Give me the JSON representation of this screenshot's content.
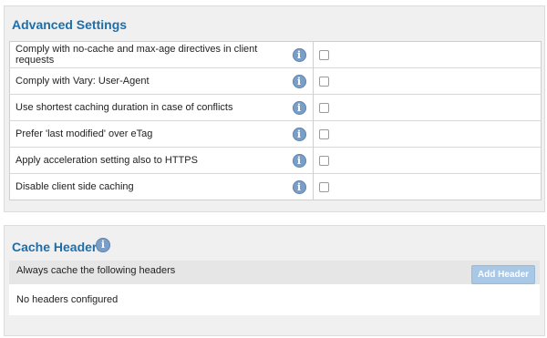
{
  "advanced_settings": {
    "title": "Advanced Settings",
    "rows": [
      {
        "label": "Comply with no-cache and max-age directives in client requests",
        "checked": false
      },
      {
        "label": "Comply with Vary: User-Agent",
        "checked": false
      },
      {
        "label": "Use shortest caching duration in case of conflicts",
        "checked": false
      },
      {
        "label": "Prefer 'last modified' over eTag",
        "checked": false
      },
      {
        "label": "Apply acceleration setting also to HTTPS",
        "checked": false
      },
      {
        "label": "Disable client side caching",
        "checked": false
      }
    ]
  },
  "cache_headers": {
    "title": "Cache Headers",
    "bar_label": "Always cache the following headers",
    "add_button_label": "Add Header",
    "empty_message": "No headers configured"
  },
  "icons": {
    "info": "info-icon",
    "info_glyph": "i"
  },
  "colors": {
    "title": "#1f6ea8",
    "info_icon": "#7a9ec6",
    "add_button": "#a9c8e6"
  }
}
